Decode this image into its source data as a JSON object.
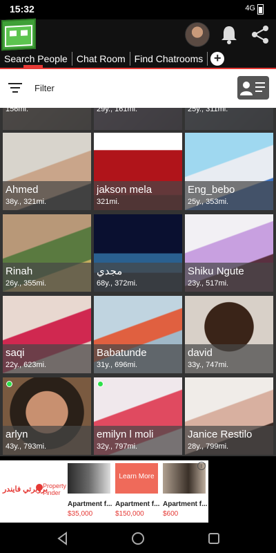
{
  "status": {
    "time": "15:32",
    "signal": "4G"
  },
  "header": {
    "icons": [
      "app-logo",
      "user-avatar",
      "bell-icon",
      "share-icon"
    ]
  },
  "tabs": [
    {
      "label": "Search People",
      "active": true
    },
    {
      "label": "Chat Room"
    },
    {
      "label": "Find Chatrooms"
    }
  ],
  "toolbar": {
    "filter_label": "Filter"
  },
  "partial_row": [
    {
      "name": "",
      "details": "156mi."
    },
    {
      "name": "",
      "details": "29y., 161mi."
    },
    {
      "name": "",
      "details": "25y., 311mi."
    }
  ],
  "people": [
    {
      "name": "Ahmed",
      "details": "38y., 321mi."
    },
    {
      "name": "jakson mela",
      "details": "321mi."
    },
    {
      "name": "Eng_bebo",
      "details": "25y., 353mi."
    },
    {
      "name": "Rinah",
      "details": "26y., 355mi."
    },
    {
      "name": "مجدي",
      "details": "68y., 372mi."
    },
    {
      "name": "Shiku Ngute",
      "details": "23y., 517mi."
    },
    {
      "name": "saqi",
      "details": "22y., 623mi."
    },
    {
      "name": "Babatunde",
      "details": "31y., 696mi."
    },
    {
      "name": "david",
      "details": "33y., 747mi."
    },
    {
      "name": "arlyn",
      "details": "43y., 793mi."
    },
    {
      "name": "emilyn l moli",
      "details": "32y., 797mi."
    },
    {
      "name": "Janice Restilo",
      "details": "28y., 799mi."
    }
  ],
  "ad": {
    "brand_ar": "بروبرتي فايندر",
    "brand_en_1": "Property",
    "brand_en_2": "Finder",
    "items": [
      {
        "title": "Apartment f...",
        "price": "$35,000"
      },
      {
        "title": "Apartment f...",
        "price": "$150,000",
        "overlay": "Learn More"
      },
      {
        "title": "Apartment f...",
        "price": "$600"
      }
    ]
  }
}
